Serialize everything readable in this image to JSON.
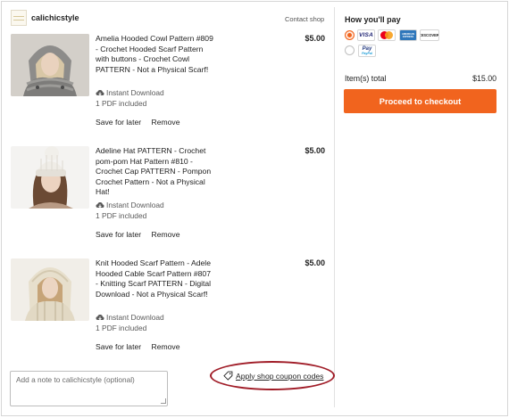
{
  "shop": {
    "name": "calichicstyle",
    "contact_label": "Contact shop",
    "logo_icon": "shop-logo-icon"
  },
  "items": [
    {
      "title": "Amelia Hooded Cowl Pattern #809 - Crochet Hooded Scarf Pattern with buttons - Crochet Cowl PATTERN - Not a Physical Scarf!",
      "price": "$5.00",
      "download_label": "Instant Download",
      "included": "1 PDF included",
      "save_label": "Save for later",
      "remove_label": "Remove",
      "colors": {
        "knit": "#8a8a8a",
        "hair": "#d8c7a6"
      }
    },
    {
      "title": "Adeline Hat PATTERN - Crochet pom-pom Hat Pattern #810 - Crochet Cap PATTERN - Pompon Crochet Pattern - Not a Physical Hat!",
      "price": "$5.00",
      "download_label": "Instant Download",
      "included": "1 PDF included",
      "save_label": "Save for later",
      "remove_label": "Remove",
      "colors": {
        "knit": "#efece6",
        "hair": "#6b4a34"
      }
    },
    {
      "title": "Knit Hooded Scarf Pattern - Adele Hooded Cable Scarf Pattern #807 - Knitting Scarf PATTERN - Digital Download - Not a Physical Scarf!",
      "price": "$5.00",
      "download_label": "Instant Download",
      "included": "1 PDF included",
      "save_label": "Save for later",
      "remove_label": "Remove",
      "colors": {
        "knit": "#e7dfcc",
        "hair": "#c6a478"
      }
    }
  ],
  "note": {
    "placeholder": "Add a note to calichicstyle (optional)"
  },
  "coupon": {
    "label": "Apply shop coupon codes",
    "icon": "tag-icon"
  },
  "payment": {
    "title": "How you'll pay",
    "methods": [
      {
        "name": "cards",
        "selected": true,
        "cards": [
          "visa",
          "mastercard",
          "amex",
          "discover"
        ]
      },
      {
        "name": "paypal",
        "selected": false
      }
    ],
    "visa_text": "VISA",
    "amex_text": "AMERICAN EXPRESS",
    "discover_text": "DISCOVER",
    "paypal_text": "Pay",
    "paypal_text2": "PayPal",
    "total_label": "Item(s) total",
    "total_value": "$15.00",
    "checkout_label": "Proceed to checkout",
    "accent_color": "#f1641e"
  }
}
